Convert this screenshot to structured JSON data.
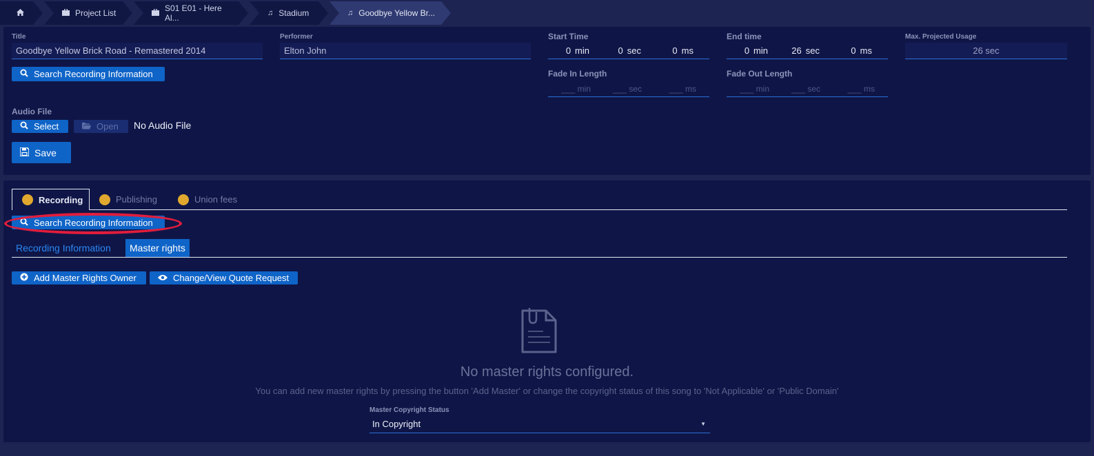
{
  "breadcrumb": {
    "items": [
      {
        "label": "",
        "icon": "home-icon"
      },
      {
        "label": "Project List",
        "icon": "briefcase-icon"
      },
      {
        "label": "S01 E01 - Here Al...",
        "icon": "briefcase-icon"
      },
      {
        "label": "Stadium",
        "icon": "music-note-icon"
      },
      {
        "label": "Goodbye Yellow Br...",
        "icon": "music-note-icon"
      }
    ]
  },
  "form": {
    "title_label": "Title",
    "title_value": "Goodbye Yellow Brick Road - Remastered 2014",
    "performer_label": "Performer",
    "performer_value": "Elton John",
    "search_button": "Search Recording Information",
    "start_time_label": "Start Time",
    "start_time": {
      "min": "0",
      "sec": "0",
      "ms": "0"
    },
    "end_time_label": "End time",
    "end_time": {
      "min": "0",
      "sec": "26",
      "ms": "0"
    },
    "max_usage_label": "Max. Projected Usage",
    "max_usage_value": "26 sec",
    "fade_in_label": "Fade In Length",
    "fade_out_label": "Fade Out Length",
    "fade_placeholder": {
      "min": "___ min",
      "sec": "___ sec",
      "ms": "___ ms"
    },
    "units": {
      "min": "min",
      "sec": "sec",
      "ms": "ms"
    },
    "audio_file_label": "Audio File",
    "select_button": "Select",
    "open_button": "Open",
    "no_audio_text": "No Audio File",
    "save_button": "Save"
  },
  "tabs": {
    "recording": "Recording",
    "publishing": "Publishing",
    "union_fees": "Union fees",
    "status_color": "#e0a82e"
  },
  "recording_section": {
    "search_button": "Search Recording Information",
    "subtab_info": "Recording Information",
    "subtab_master": "Master rights",
    "add_owner_button": "Add Master Rights Owner",
    "quote_button": "Change/View Quote Request",
    "empty_title": "No master rights configured.",
    "empty_subtitle": "You can add new master rights by pressing the button 'Add Master' or change the copyright status of this song to 'Not Applicable' or 'Public Domain'",
    "status_label": "Master Copyright Status",
    "status_value": "In Copyright"
  },
  "colors": {
    "background": "#1e2452",
    "panel": "#0f1647",
    "accent": "#0f64c8",
    "highlight": "#e11d3c"
  }
}
